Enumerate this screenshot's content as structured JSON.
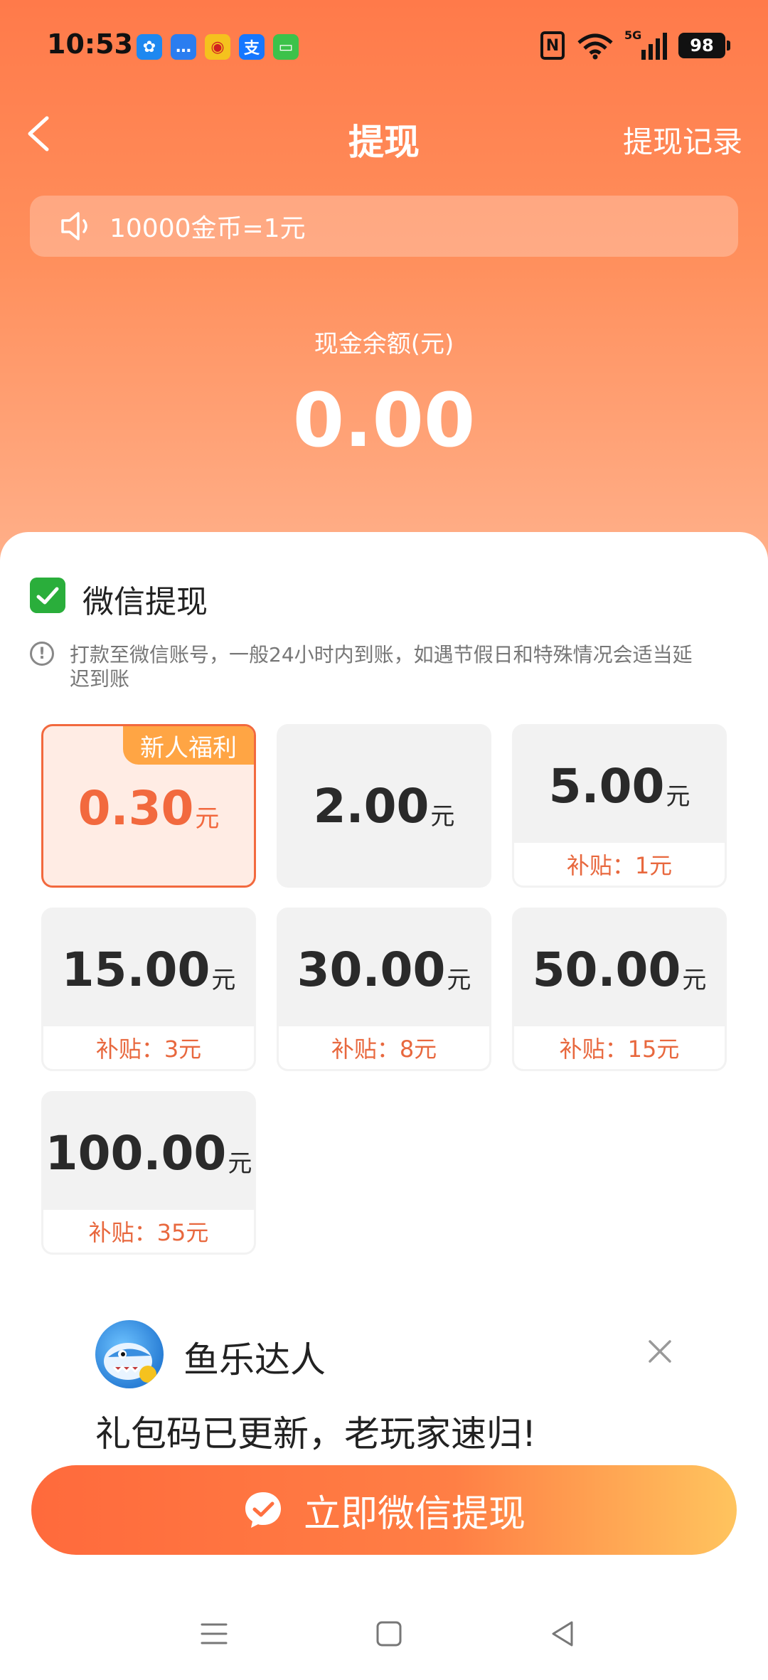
{
  "status_bar": {
    "time": "10:53",
    "network_tag": "5G",
    "battery": "98",
    "apps": [
      {
        "name": "fan-app-icon",
        "color": "#1e88f0",
        "glyph": "✿"
      },
      {
        "name": "message-app-icon",
        "color": "#2a7df0",
        "glyph": "…"
      },
      {
        "name": "weibo-app-icon",
        "color": "#f5c21e",
        "glyph": "◉"
      },
      {
        "name": "alipay-app-icon",
        "color": "#1677ff",
        "glyph": "支"
      },
      {
        "name": "chat-app-icon",
        "color": "#3cc24a",
        "glyph": "▭"
      }
    ]
  },
  "header": {
    "title": "提现",
    "records_link": "提现记录"
  },
  "notice": {
    "text": "10000金币=1元"
  },
  "balance": {
    "label": "现金余额(元)",
    "value": "0.00"
  },
  "wechat_section": {
    "title": "微信提现",
    "info": "打款至微信账号，一般24小时内到账，如遇节假日和特殊情况会适当延迟到账"
  },
  "amounts": [
    {
      "value": "0.30",
      "unit": "元",
      "badge": "新人福利",
      "selected": true
    },
    {
      "value": "2.00",
      "unit": "元"
    },
    {
      "value": "5.00",
      "unit": "元",
      "subsidy": "补贴：1元"
    },
    {
      "value": "15.00",
      "unit": "元",
      "subsidy": "补贴：3元"
    },
    {
      "value": "30.00",
      "unit": "元",
      "subsidy": "补贴：8元"
    },
    {
      "value": "50.00",
      "unit": "元",
      "subsidy": "补贴：15元"
    },
    {
      "value": "100.00",
      "unit": "元",
      "subsidy": "补贴：35元"
    }
  ],
  "promo": {
    "name": "鱼乐达人",
    "text": "礼包码已更新，老玩家速归!"
  },
  "cta": {
    "label": "立即微信提现"
  },
  "colors": {
    "accent": "#f2693e",
    "badge": "#ffa544",
    "wechat_green": "#2aae3b"
  }
}
